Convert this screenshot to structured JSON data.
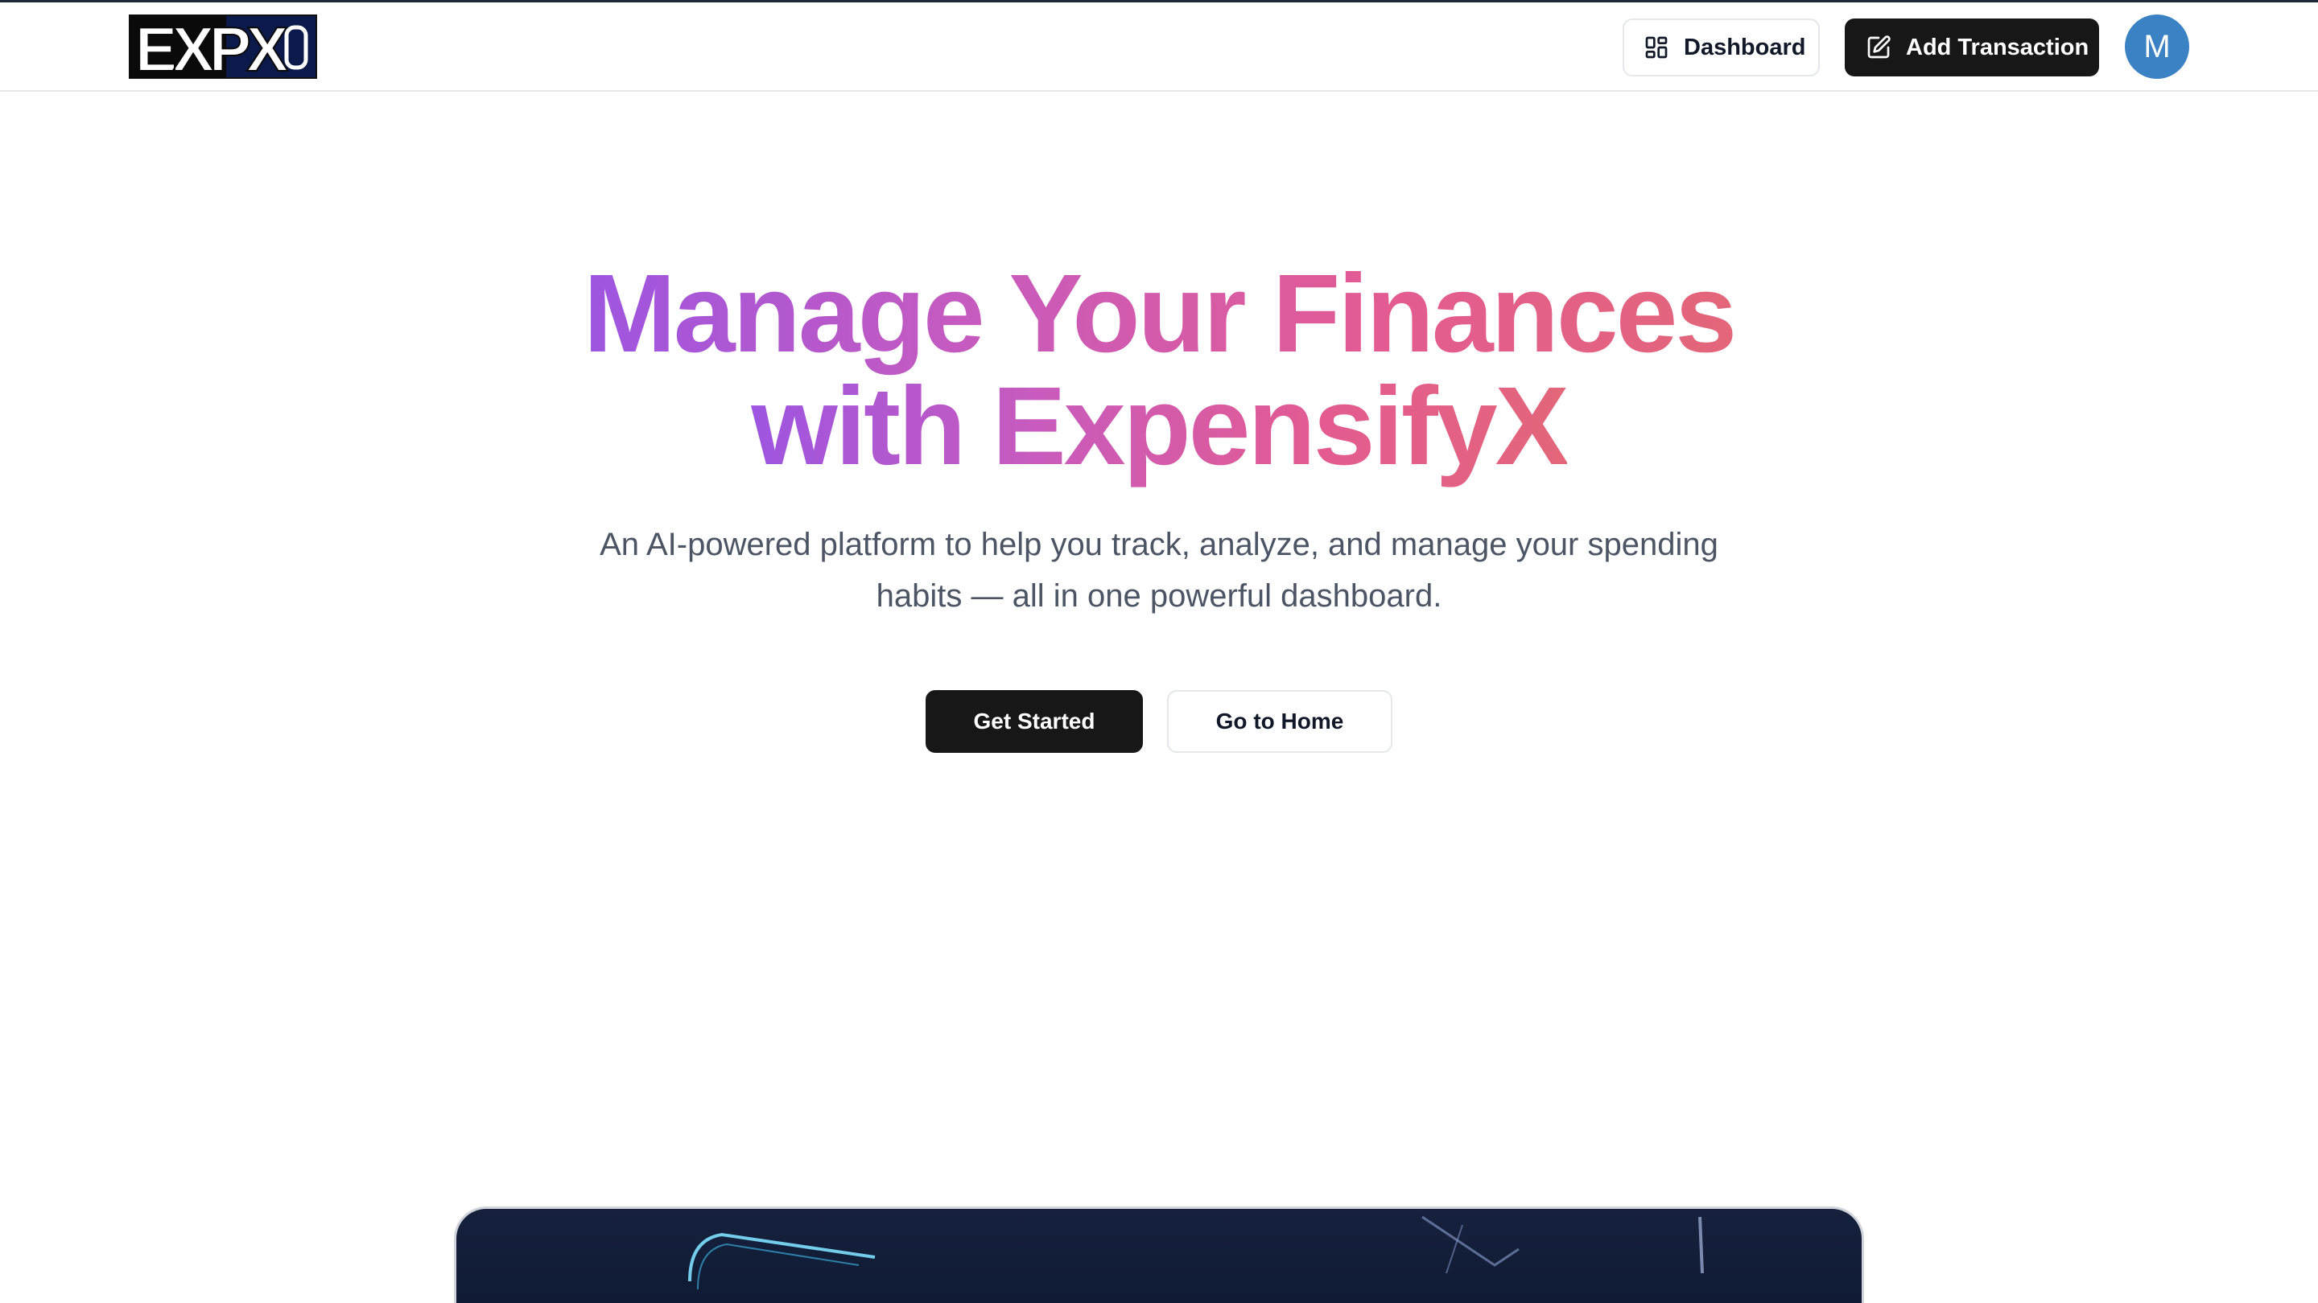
{
  "header": {
    "logo_text": "EXPX",
    "dashboard_label": "Dashboard",
    "add_transaction_label": "Add Transaction",
    "avatar_initial": "M"
  },
  "hero": {
    "title_line1": "Manage Your Finances",
    "title_line2": "with ExpensifyX",
    "subtitle": "An AI-powered platform to help you track, analyze, and manage your spending habits — all in one powerful dashboard.",
    "primary_cta": "Get Started",
    "secondary_cta": "Go to Home"
  },
  "icons": {
    "dashboard": "layout-grid-icon",
    "add_transaction": "pen-square-icon"
  },
  "colors": {
    "primary_button": "#171717",
    "avatar": "#3b82c4",
    "gradient_start": "#9d55e0",
    "gradient_end": "#e3667a",
    "subtitle_text": "#4b5563"
  }
}
